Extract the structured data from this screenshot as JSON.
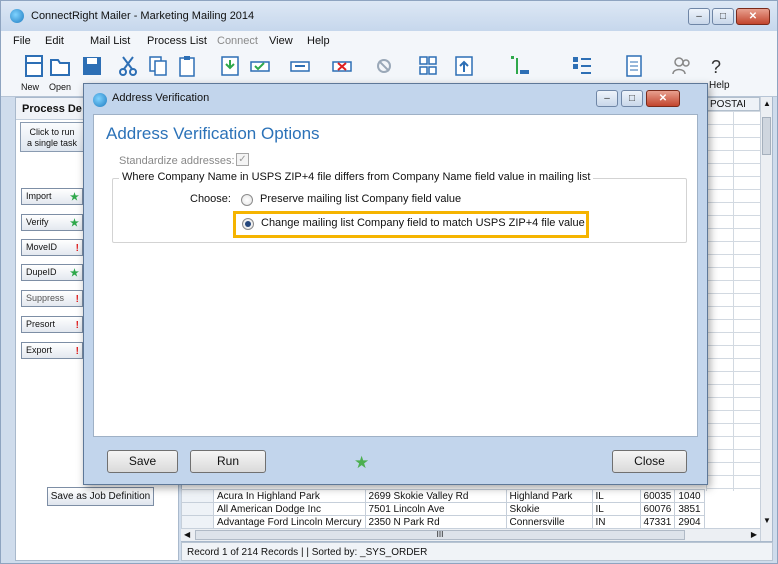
{
  "window": {
    "title": "ConnectRight Mailer - Marketing Mailing 2014",
    "min_symbol": "–",
    "max_symbol": "□",
    "close_symbol": "✕"
  },
  "menu": [
    "File",
    "Edit",
    "Mail List",
    "Process List",
    "Connect",
    "View",
    "Help"
  ],
  "toolbar": {
    "labels": {
      "new": "New",
      "open": "Open",
      "help": "Help"
    },
    "help_glyph": "?"
  },
  "process_panel": {
    "header": "Process De",
    "run_single_line1": "Click to run",
    "run_single_line2": "a single task",
    "tasks": [
      {
        "label": "Import",
        "mark": "★"
      },
      {
        "label": "Verify",
        "mark": "★"
      },
      {
        "label": "MoveID",
        "mark": "!"
      },
      {
        "label": "DupeID",
        "mark": "★"
      },
      {
        "label": "Suppress",
        "mark": "!"
      },
      {
        "label": "Presort",
        "mark": "!"
      },
      {
        "label": "Export",
        "mark": "!"
      }
    ],
    "save_job": "Save as Job Definition"
  },
  "grid": {
    "postal_header": "POSTAI",
    "rows": [
      [
        "Acura In Highland Park",
        "2699 Skokie Valley Rd",
        "Highland Park",
        "IL",
        "60035",
        "1040"
      ],
      [
        "All American Dodge Inc",
        "7501 Lincoln Ave",
        "Skokie",
        "IL",
        "60076",
        "3851"
      ],
      [
        "Advantage Ford Lincoln Mercury",
        "2350 N Park Rd",
        "Connersville",
        "IN",
        "47331",
        "2904"
      ]
    ],
    "hscroll_grip": "III",
    "status": "Record 1 of 214 Records  |  |  Sorted by: _SYS_ORDER"
  },
  "dialog": {
    "title": "Address Verification",
    "heading": "Address Verification Options",
    "standardize_label": "Standardize addresses:",
    "standardize_checked": true,
    "group_caption": "Where Company Name in USPS ZIP+4 file differs from Company Name field value in mailing list",
    "choose_label": "Choose:",
    "options": [
      {
        "label": "Preserve mailing list Company field value",
        "selected": false
      },
      {
        "label": "Change mailing list Company field to match USPS ZIP+4 file value",
        "selected": true
      }
    ],
    "buttons": {
      "save": "Save",
      "run": "Run",
      "close": "Close"
    }
  },
  "colors": {
    "heading_blue": "#2b72b8",
    "highlight": "#f5b400",
    "star_green": "#4caf50",
    "alert_red": "#e02020"
  }
}
